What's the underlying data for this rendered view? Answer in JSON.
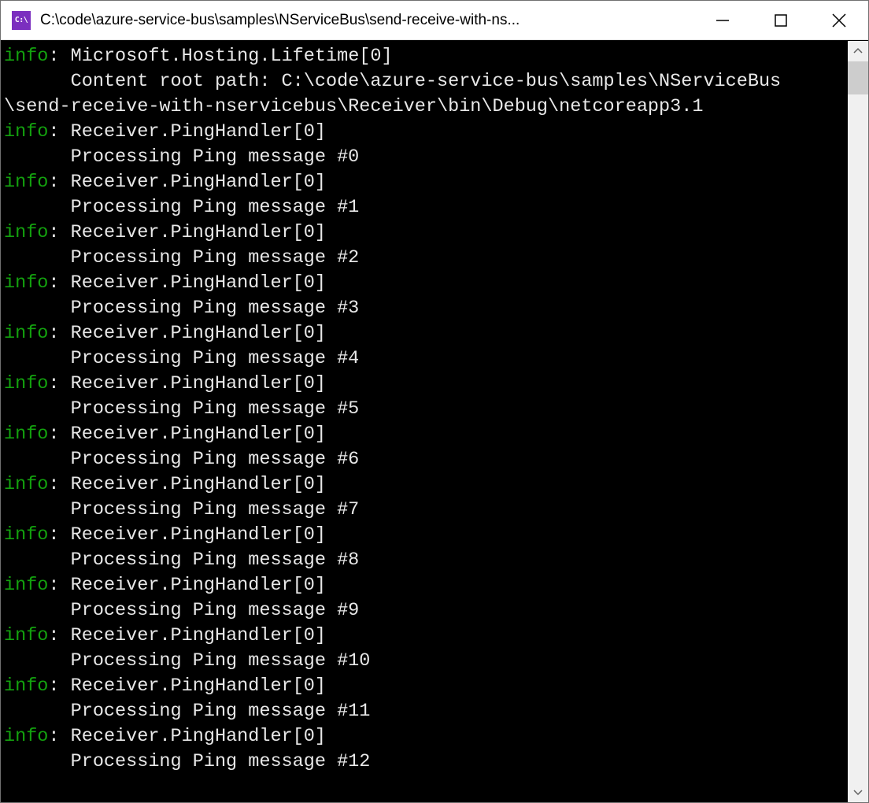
{
  "titlebar": {
    "icon_label": "C:\\",
    "title": "C:\\code\\azure-service-bus\\samples\\NServiceBus\\send-receive-with-ns..."
  },
  "controls": {
    "minimize_name": "minimize-button",
    "maximize_name": "maximize-button",
    "close_name": "close-button"
  },
  "log": {
    "header": {
      "level": "info",
      "source": "Microsoft.Hosting.Lifetime[0]",
      "continuation": "      Content root path: C:\\code\\azure-service-bus\\samples\\NServiceBus\n\\send-receive-with-nservicebus\\Receiver\\bin\\Debug\\netcoreapp3.1"
    },
    "entries": [
      {
        "level": "info",
        "source": "Receiver.PingHandler[0]",
        "message": "Processing Ping message #0"
      },
      {
        "level": "info",
        "source": "Receiver.PingHandler[0]",
        "message": "Processing Ping message #1"
      },
      {
        "level": "info",
        "source": "Receiver.PingHandler[0]",
        "message": "Processing Ping message #2"
      },
      {
        "level": "info",
        "source": "Receiver.PingHandler[0]",
        "message": "Processing Ping message #3"
      },
      {
        "level": "info",
        "source": "Receiver.PingHandler[0]",
        "message": "Processing Ping message #4"
      },
      {
        "level": "info",
        "source": "Receiver.PingHandler[0]",
        "message": "Processing Ping message #5"
      },
      {
        "level": "info",
        "source": "Receiver.PingHandler[0]",
        "message": "Processing Ping message #6"
      },
      {
        "level": "info",
        "source": "Receiver.PingHandler[0]",
        "message": "Processing Ping message #7"
      },
      {
        "level": "info",
        "source": "Receiver.PingHandler[0]",
        "message": "Processing Ping message #8"
      },
      {
        "level": "info",
        "source": "Receiver.PingHandler[0]",
        "message": "Processing Ping message #9"
      },
      {
        "level": "info",
        "source": "Receiver.PingHandler[0]",
        "message": "Processing Ping message #10"
      },
      {
        "level": "info",
        "source": "Receiver.PingHandler[0]",
        "message": "Processing Ping message #11"
      },
      {
        "level": "info",
        "source": "Receiver.PingHandler[0]",
        "message": "Processing Ping message #12"
      }
    ]
  }
}
